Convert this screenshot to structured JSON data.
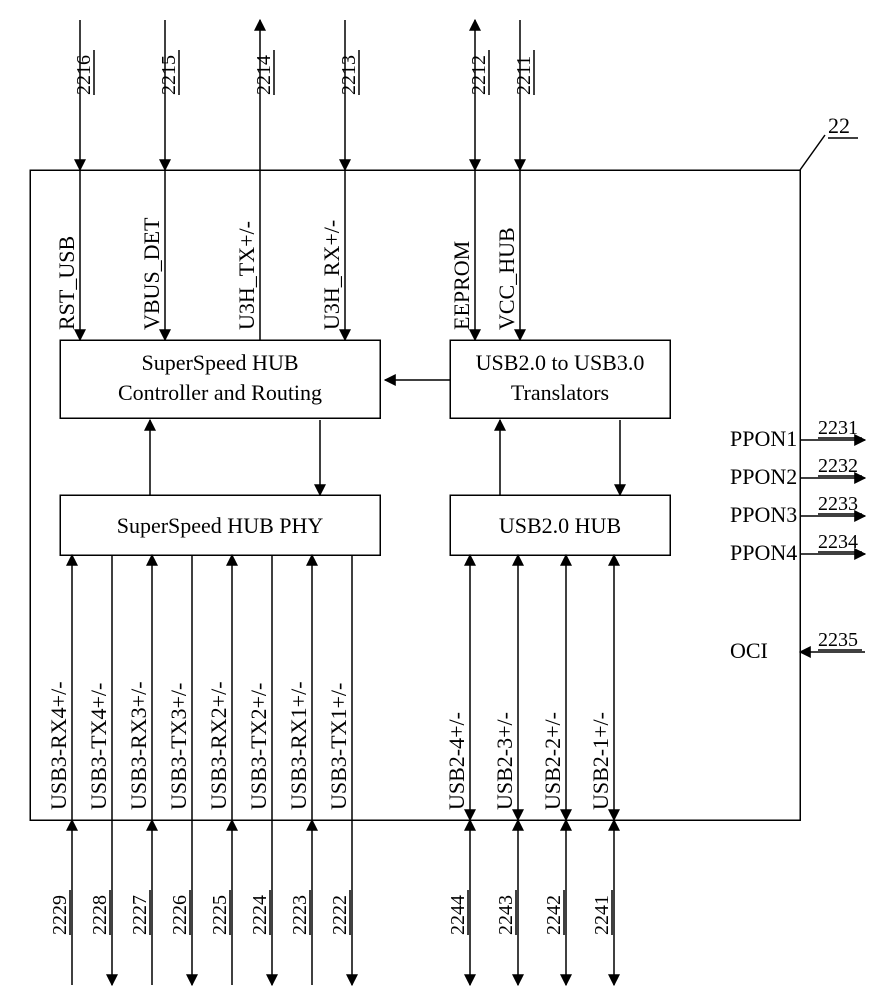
{
  "ref_label": "22",
  "blocks": {
    "controller": "SuperSpeed HUB",
    "controller2": "Controller and Routing",
    "translators": "USB2.0 to USB3.0",
    "translators2": "Translators",
    "phy": "SuperSpeed HUB PHY",
    "usb2hub": "USB2.0 HUB"
  },
  "top_signals": [
    {
      "name": "RST_USB",
      "num": "2216",
      "dir": "in"
    },
    {
      "name": "VBUS_DET",
      "num": "2215",
      "dir": "in"
    },
    {
      "name": "U3H_TX+/-",
      "num": "2214",
      "dir": "out"
    },
    {
      "name": "U3H_RX+/-",
      "num": "2213",
      "dir": "in"
    },
    {
      "name": "EEPROM",
      "num": "2212",
      "dir": "bi"
    },
    {
      "name": "VCC_HUB",
      "num": "2211",
      "dir": "in"
    }
  ],
  "right_signals": [
    {
      "name": "PPON1",
      "num": "2231",
      "dir": "out"
    },
    {
      "name": "PPON2",
      "num": "2232",
      "dir": "out"
    },
    {
      "name": "PPON3",
      "num": "2233",
      "dir": "out"
    },
    {
      "name": "PPON4",
      "num": "2234",
      "dir": "out"
    },
    {
      "name": "OCI",
      "num": "2235",
      "dir": "in"
    }
  ],
  "bottom_ss_signals": [
    {
      "name": "USB3-RX4+/-",
      "num": "2229"
    },
    {
      "name": "USB3-TX4+/-",
      "num": "2228"
    },
    {
      "name": "USB3-RX3+/-",
      "num": "2227"
    },
    {
      "name": "USB3-TX3+/-",
      "num": "2226"
    },
    {
      "name": "USB3-RX2+/-",
      "num": "2225"
    },
    {
      "name": "USB3-TX2+/-",
      "num": "2224"
    },
    {
      "name": "USB3-RX1+/-",
      "num": "2223"
    },
    {
      "name": "USB3-TX1+/-",
      "num": "2222"
    }
  ],
  "bottom_usb2_signals": [
    {
      "name": "USB2-4+/-",
      "num": "2244"
    },
    {
      "name": "USB2-3+/-",
      "num": "2243"
    },
    {
      "name": "USB2-2+/-",
      "num": "2242"
    },
    {
      "name": "USB2-1+/-",
      "num": "2241"
    }
  ]
}
